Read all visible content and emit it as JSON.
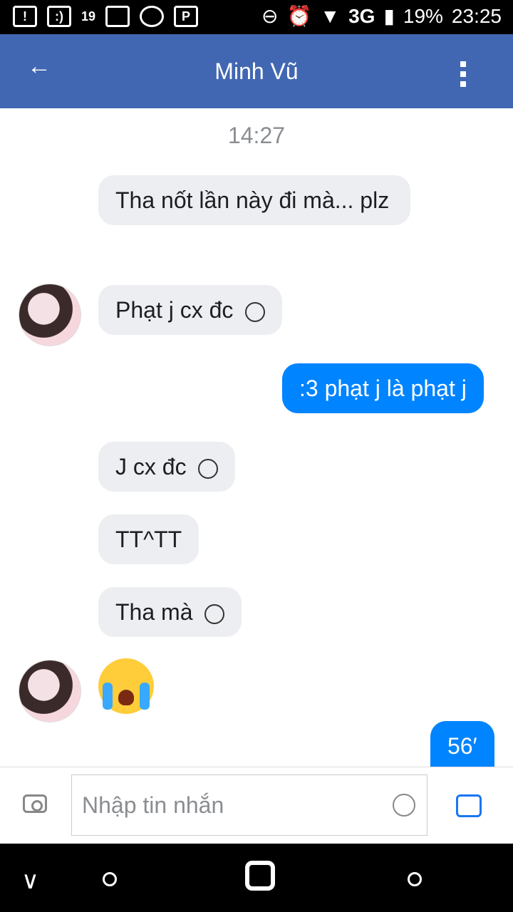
{
  "status_bar": {
    "network": "3G",
    "battery_percent": "19%",
    "time": "23:25",
    "notification_badge": "19"
  },
  "header": {
    "back_icon": "back-arrow-icon",
    "title": "Minh Vũ",
    "menu_icon": "more-vert-icon"
  },
  "chat": {
    "timestamp": "14:27",
    "messages": [
      {
        "from": "them",
        "text": "Tha nốt lần này đi mà... plz"
      },
      {
        "from": "them",
        "text": "Phạt j cx đc",
        "emoji": "frowning-icon"
      },
      {
        "from": "me",
        "text": ":3 phạt j là phạt j"
      },
      {
        "from": "them",
        "text": "J cx đc",
        "emoji": "frowning-icon"
      },
      {
        "from": "them",
        "text": "TT^TT"
      },
      {
        "from": "them",
        "text": "Tha mà",
        "emoji": "sad-face-icon"
      },
      {
        "from": "them",
        "emoji": "crying-face-icon"
      },
      {
        "from": "me",
        "text": "56′"
      }
    ]
  },
  "input": {
    "placeholder": "Nhập tin nhắn",
    "camera_icon": "camera-icon",
    "emoji_icon": "smiley-icon",
    "like_icon": "thumbs-up-icon"
  },
  "navigation": {
    "back_icon": "nav-back-icon",
    "home_icon": "home-icon",
    "recent_icon": "recent-apps-icon"
  },
  "colors": {
    "header_bg": "#4267b2",
    "my_bubble": "#0084ff",
    "their_bubble": "#eceef1"
  }
}
